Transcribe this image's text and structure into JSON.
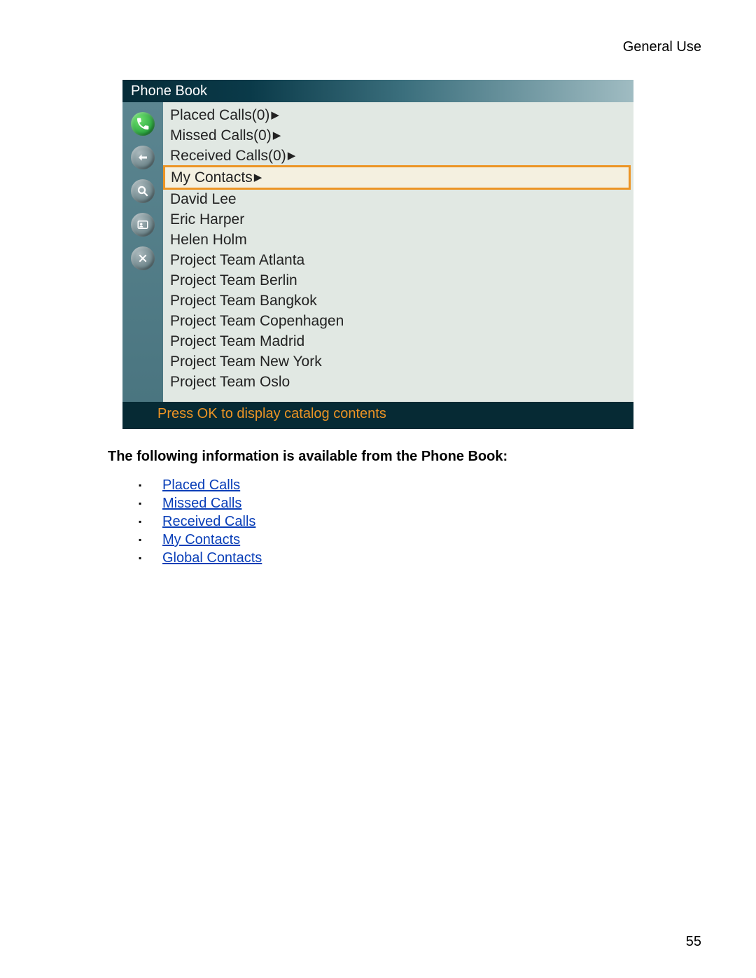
{
  "header": {
    "section": "General Use"
  },
  "page_number": "55",
  "phonebook": {
    "title": "Phone Book",
    "footer": "Press OK to display catalog contents",
    "icons": [
      "phone-icon",
      "back-icon",
      "search-icon",
      "contact-card-icon",
      "close-icon"
    ],
    "rows": [
      {
        "label": "Placed Calls(0)",
        "has_arrow": true,
        "selected": false
      },
      {
        "label": "Missed Calls(0)",
        "has_arrow": true,
        "selected": false
      },
      {
        "label": "Received Calls(0)",
        "has_arrow": true,
        "selected": false
      },
      {
        "label": "My Contacts",
        "has_arrow": true,
        "selected": true
      },
      {
        "label": "David Lee",
        "has_arrow": false,
        "selected": false
      },
      {
        "label": "Eric Harper",
        "has_arrow": false,
        "selected": false
      },
      {
        "label": "Helen Holm",
        "has_arrow": false,
        "selected": false
      },
      {
        "label": "Project Team Atlanta",
        "has_arrow": false,
        "selected": false
      },
      {
        "label": "Project Team Berlin",
        "has_arrow": false,
        "selected": false
      },
      {
        "label": "Project Team Bangkok",
        "has_arrow": false,
        "selected": false
      },
      {
        "label": "Project Team Copenhagen",
        "has_arrow": false,
        "selected": false
      },
      {
        "label": "Project Team Madrid",
        "has_arrow": false,
        "selected": false
      },
      {
        "label": "Project Team New York",
        "has_arrow": false,
        "selected": false
      },
      {
        "label": "Project Team Oslo",
        "has_arrow": false,
        "selected": false
      }
    ]
  },
  "doc": {
    "intro": "The following information is available from the Phone Book:",
    "links": [
      "Placed Calls",
      "Missed Calls",
      "Received Calls",
      "My Contacts",
      "Global Contacts"
    ]
  }
}
